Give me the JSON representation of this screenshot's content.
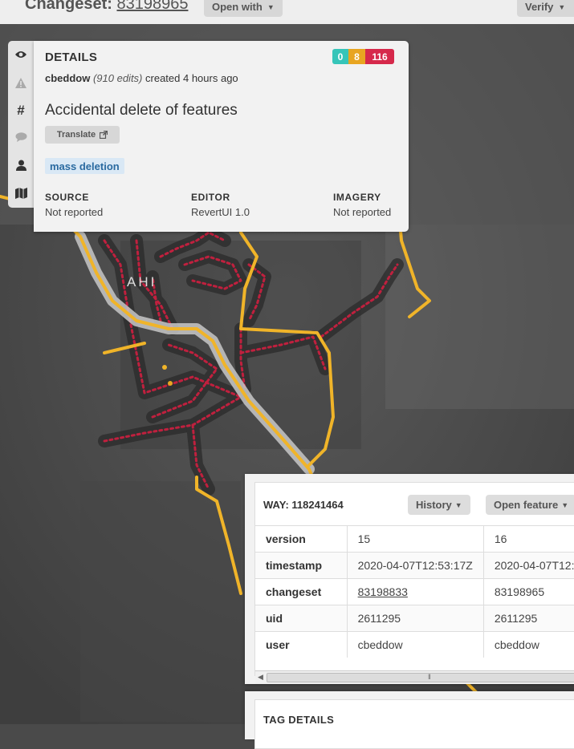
{
  "header": {
    "changeset_label": "Changeset:",
    "changeset_id": "83198965",
    "open_with_label": "Open with",
    "verify_label": "Verify"
  },
  "sidebar": {
    "icons": [
      "eye-icon",
      "warning-icon",
      "hash-icon",
      "comment-icon",
      "user-icon",
      "map-icon"
    ]
  },
  "details": {
    "title": "DETAILS",
    "counts": {
      "added": "0",
      "modified": "8",
      "deleted": "116"
    },
    "user": "cbeddow",
    "edits": "(910 edits)",
    "created": "created 4 hours ago",
    "comment": "Accidental delete of features",
    "translate_label": "Translate",
    "tag": "mass deletion",
    "source_key": "SOURCE",
    "source_value": "Not reported",
    "editor_key": "EDITOR",
    "editor_value": "RevertUI 1.0",
    "imagery_key": "IMAGERY",
    "imagery_value": "Not reported"
  },
  "map": {
    "place_label": "AHI"
  },
  "way": {
    "title": "WAY: 118241464",
    "history_label": "History",
    "open_feature_label": "Open feature",
    "rows": [
      {
        "key": "version",
        "old": "15",
        "new": "16"
      },
      {
        "key": "timestamp",
        "old": "2020-04-07T12:53:17Z",
        "new": "2020-04-07T12:"
      },
      {
        "key": "changeset",
        "old": "83198833",
        "new": "83198965"
      },
      {
        "key": "uid",
        "old": "2611295",
        "new": "2611295"
      },
      {
        "key": "user",
        "old": "cbeddow",
        "new": "cbeddow"
      }
    ]
  },
  "tag_details": {
    "title": "TAG DETAILS"
  },
  "colors": {
    "added": "#36c5b9",
    "modified": "#e8a521",
    "deleted": "#d6294b",
    "road": "#f0b429"
  }
}
